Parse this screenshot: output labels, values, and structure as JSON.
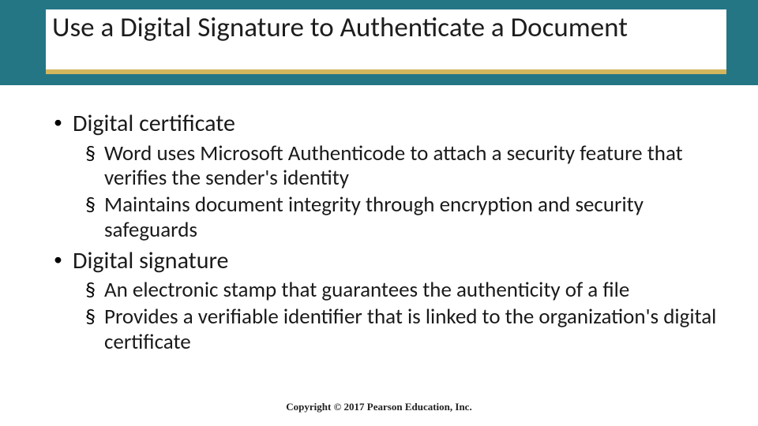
{
  "slide": {
    "title": "Use a Digital Signature to Authenticate a Document",
    "bullets": {
      "b1": {
        "label": "Digital certificate",
        "subs": {
          "s1": "Word uses Microsoft Authenticode to attach a security feature that verifies the sender's identity",
          "s2": "Maintains document integrity through encryption and security safeguards"
        }
      },
      "b2": {
        "label": "Digital signature",
        "subs": {
          "s1": "An electronic stamp that guarantees the authenticity of a file",
          "s2": "Provides a verifiable identifier that is linked to the organization's digital certificate"
        }
      }
    },
    "footer": "Copyright © 2017 Pearson Education, Inc."
  }
}
